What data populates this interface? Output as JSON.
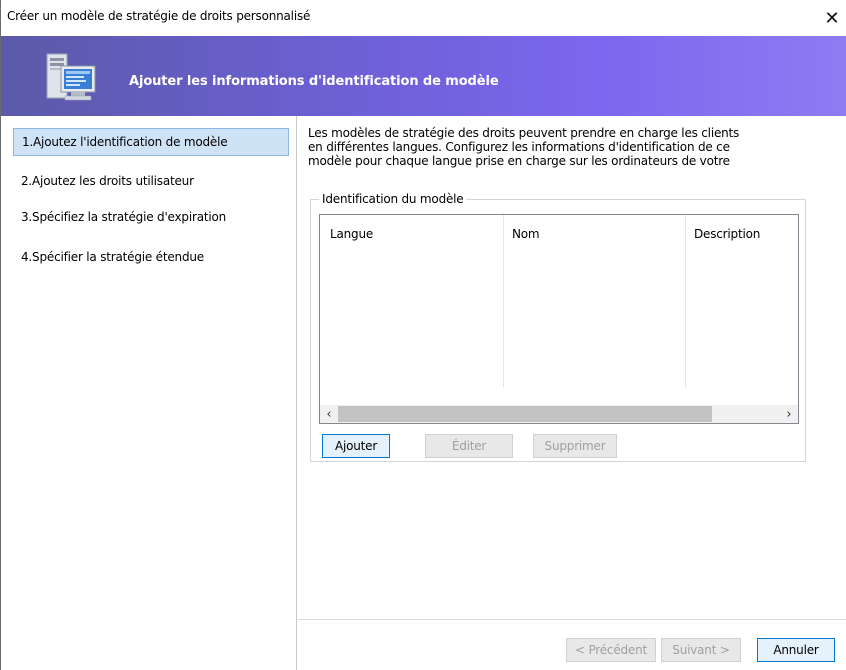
{
  "window": {
    "title": "Créer un modèle de stratégie de droits personnalisé",
    "close_glyph": "✕"
  },
  "banner": {
    "heading": "Ajouter les informations d'identification de modèle",
    "icon": "server-computer-icon"
  },
  "steps": [
    {
      "label": "1.Ajoutez l'identification de modèle",
      "active": true
    },
    {
      "label": "2.Ajoutez les droits utilisateur",
      "active": false
    },
    {
      "label": "3.Spécifiez la stratégie d'expiration",
      "active": false
    },
    {
      "label": "4.Spécifier la stratégie étendue",
      "active": false
    }
  ],
  "content": {
    "intro_lines": [
      "Les modèles de stratégie des droits peuvent prendre en charge les clients",
      "en différentes langues. Configurez les informations d'identification de ce",
      "modèle pour chaque langue prise en charge sur les ordinateurs de votre"
    ],
    "group_title": "Identification du modèle",
    "columns": [
      "Langue",
      "Nom",
      "Description"
    ],
    "rows": [],
    "scroll_left": "‹",
    "scroll_right": "›",
    "buttons": {
      "add": "Ajouter",
      "edit": "Éditer",
      "delete": "Supprimer"
    }
  },
  "footer": {
    "previous": "< Précédent",
    "next": "Suivant >",
    "cancel": "Annuler"
  },
  "colors": {
    "banner_start": "#5b5aa8",
    "banner_end": "#8f7bf2",
    "selected_step": "#cfe3f7"
  }
}
